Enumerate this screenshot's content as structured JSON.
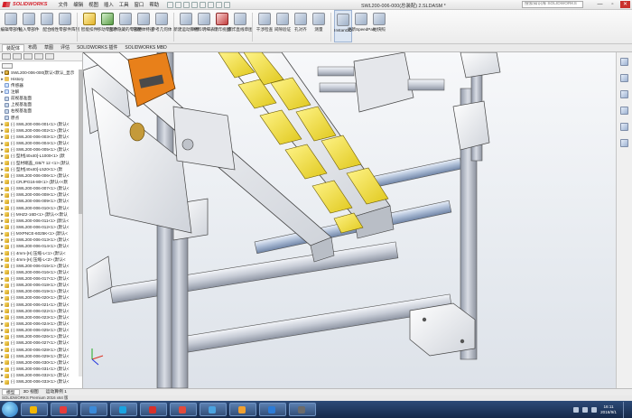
{
  "app": {
    "logo_text": "SOLIDWORKS",
    "menu": [
      "文件",
      "编辑",
      "视图",
      "插入",
      "工具",
      "窗口",
      "帮助"
    ],
    "document_title": "SWL200-006-000(总装配) 2.SLDASM *",
    "search_placeholder": "搜索知识库 SOLIDWORKS",
    "window_controls": [
      "—",
      "▫",
      "✕"
    ]
  },
  "ribbon": {
    "buttons": [
      {
        "label": "编辑零部件",
        "icon": "edit-component-icon",
        "tone": ""
      },
      {
        "label": "插入零部件",
        "icon": "insert-component-icon",
        "tone": ""
      },
      {
        "label": "配合",
        "icon": "mate-icon",
        "tone": ""
      },
      {
        "label": "线性零部件阵列",
        "icon": "linear-pattern-icon",
        "tone": ""
      },
      {
        "label": "智能扣件",
        "icon": "smart-fasteners-icon",
        "tone": "y"
      },
      {
        "label": "移动零部件",
        "icon": "move-component-icon",
        "tone": "g"
      },
      {
        "label": "显示隐藏的零部件",
        "icon": "show-hidden-icon",
        "tone": ""
      },
      {
        "label": "装配体特征",
        "icon": "assembly-features-icon",
        "tone": ""
      },
      {
        "label": "参考几何体",
        "icon": "reference-geometry-icon",
        "tone": ""
      },
      {
        "label": "新建运动算例",
        "icon": "motion-study-icon",
        "tone": ""
      },
      {
        "label": "材料明细表",
        "icon": "bom-icon",
        "tone": ""
      },
      {
        "label": "爆炸视图",
        "icon": "exploded-view-icon",
        "tone": "r"
      },
      {
        "label": "爆炸直线草图",
        "icon": "explode-line-icon",
        "tone": ""
      },
      {
        "label": "干涉检查",
        "icon": "interference-icon",
        "tone": ""
      },
      {
        "label": "间隙验证",
        "icon": "clearance-icon",
        "tone": ""
      },
      {
        "label": "孔对齐",
        "icon": "hole-alignment-icon",
        "tone": ""
      },
      {
        "label": "测量",
        "icon": "measure-icon",
        "tone": ""
      },
      {
        "label": "Instant3D",
        "icon": "instant3d-icon",
        "tone": "active"
      },
      {
        "label": "更新SpeedPak",
        "icon": "speedpak-icon",
        "tone": ""
      },
      {
        "label": "拍快照",
        "icon": "snapshot-icon",
        "tone": ""
      }
    ]
  },
  "command_tabs": [
    {
      "label": "装配体",
      "active": true
    },
    {
      "label": "布局",
      "active": false
    },
    {
      "label": "草图",
      "active": false
    },
    {
      "label": "评估",
      "active": false
    },
    {
      "label": "SOLIDWORKS 插件",
      "active": false
    },
    {
      "label": "SOLIDWORKS MBD",
      "active": false
    }
  ],
  "feature_tree": {
    "items": [
      {
        "text": "SWL200-006-000(默认<默认_显示",
        "kind": "asm",
        "exp": "▾"
      },
      {
        "text": "History",
        "kind": "folder",
        "exp": "▸"
      },
      {
        "text": "传感器",
        "kind": "note",
        "exp": ""
      },
      {
        "text": "注解",
        "kind": "note",
        "exp": "▸"
      },
      {
        "text": "前视基准面",
        "kind": "plane",
        "exp": ""
      },
      {
        "text": "上视基准面",
        "kind": "plane",
        "exp": ""
      },
      {
        "text": "右视基准面",
        "kind": "plane",
        "exp": ""
      },
      {
        "text": "原点",
        "kind": "plane",
        "exp": ""
      },
      {
        "text": "(-) SWL200-006-001<1> (默认<",
        "kind": "part",
        "exp": "▸"
      },
      {
        "text": "(-) SWL200-006-002<1> (默认<",
        "kind": "part",
        "exp": "▸"
      },
      {
        "text": "(-) SWL200-006-003<1> (默认<",
        "kind": "part",
        "exp": "▸"
      },
      {
        "text": "(-) SWL200-006-004<1> (默认<",
        "kind": "part",
        "exp": "▸"
      },
      {
        "text": "(-) SWL200-006-005<1> (默认<",
        "kind": "part",
        "exp": "▸"
      },
      {
        "text": "(-) 型材[40x40]-L1000<1> (默",
        "kind": "part",
        "exp": "▸"
      },
      {
        "text": "(-) 型材端盖_GB/T 12 <1> (默认",
        "kind": "part",
        "exp": "▸"
      },
      {
        "text": "(-) 型材[40x40]-L520<1> (默",
        "kind": "part",
        "exp": "▸"
      },
      {
        "text": "(-) SWL200-006-006<1> (默认<",
        "kind": "part",
        "exp": "▸"
      },
      {
        "text": "(-) CRJPG16-80<1> (默认<<默",
        "kind": "part",
        "exp": "▸"
      },
      {
        "text": "(-) SWL200-006-007<1> (默认<",
        "kind": "part",
        "exp": "▸"
      },
      {
        "text": "(-) SWL200-006-008<1> (默认<",
        "kind": "part",
        "exp": "▸"
      },
      {
        "text": "(-) SWL200-006-009<1> (默认<",
        "kind": "part",
        "exp": "▸"
      },
      {
        "text": "(-) SWL200-006-010<1> (默认<",
        "kind": "part",
        "exp": "▸"
      },
      {
        "text": "(-) MHZ2-16D<1> (默认<<默认",
        "kind": "part",
        "exp": "▸"
      },
      {
        "text": "(-) SWL200-006-011<1> (默认<",
        "kind": "part",
        "exp": "▸"
      },
      {
        "text": "(-) SWL200-006-012<1> (默认<",
        "kind": "part",
        "exp": "▸"
      },
      {
        "text": "(-) MXPNCE-6025K<1> (默认<",
        "kind": "part",
        "exp": "▸"
      },
      {
        "text": "(-) SWL200-006-013<1> (默认<",
        "kind": "part",
        "exp": "▸"
      },
      {
        "text": "(-) SWL200-006-014<1> (默认<",
        "kind": "part",
        "exp": "▸"
      },
      {
        "text": "(-) 4mm-[H] 压缩-L<1> (默认<",
        "kind": "part",
        "exp": "▸"
      },
      {
        "text": "(-) 4mm-[H] 压缩-L<2> (默认<",
        "kind": "part",
        "exp": "▸"
      },
      {
        "text": "(-) SWL200-006-015<1> (默认<",
        "kind": "part",
        "exp": "▸"
      },
      {
        "text": "(-) SWL200-006-016<1> (默认<",
        "kind": "part",
        "exp": "▸"
      },
      {
        "text": "(-) SWL200-006-017<1> (默认<",
        "kind": "part",
        "exp": "▸"
      },
      {
        "text": "(-) SWL200-006-018<1> (默认<",
        "kind": "part",
        "exp": "▸"
      },
      {
        "text": "(-) SWL200-006-019<1> (默认<",
        "kind": "part",
        "exp": "▸"
      },
      {
        "text": "(-) SWL200-006-020<1> (默认<",
        "kind": "part",
        "exp": "▸"
      },
      {
        "text": "(-) SWL200-006-021<1> (默认<",
        "kind": "part",
        "exp": "▸"
      },
      {
        "text": "(-) SWL200-006-022<1> (默认<",
        "kind": "part",
        "exp": "▸"
      },
      {
        "text": "(-) SWL200-006-023<1> (默认<",
        "kind": "part",
        "exp": "▸"
      },
      {
        "text": "(-) SWL200-006-024<1> (默认<",
        "kind": "part",
        "exp": "▸"
      },
      {
        "text": "(-) SWL200-006-025<1> (默认<",
        "kind": "part",
        "exp": "▸"
      },
      {
        "text": "(-) SWL200-006-026<1> (默认<",
        "kind": "part",
        "exp": "▸"
      },
      {
        "text": "(-) SWL200-006-027<1> (默认<",
        "kind": "part",
        "exp": "▸"
      },
      {
        "text": "(-) SWL200-006-028<1> (默认<",
        "kind": "part",
        "exp": "▸"
      },
      {
        "text": "(-) SWL200-006-029<1> (默认<",
        "kind": "part",
        "exp": "▸"
      },
      {
        "text": "(-) SWL200-006-030<1> (默认<",
        "kind": "part",
        "exp": "▸"
      },
      {
        "text": "(-) SWL200-006-031<1> (默认<",
        "kind": "part",
        "exp": "▸"
      },
      {
        "text": "(-) SWL200-006-032<1> (默认<",
        "kind": "part",
        "exp": "▸"
      },
      {
        "text": "(-) SWL200-006-033<1> (默认<",
        "kind": "part",
        "exp": "▸"
      }
    ]
  },
  "model_tabs": [
    {
      "label": "模型",
      "active": true
    },
    {
      "label": "3D 视图",
      "active": false
    },
    {
      "label": "运动算例 1",
      "active": false
    }
  ],
  "status": {
    "text": "SOLIDWORKS Premium 2016 x64 版"
  },
  "taskbar": {
    "apps": [
      {
        "label": "",
        "color": "#f2b705",
        "icon": "folder-icon"
      },
      {
        "label": "",
        "color": "#e63c3c",
        "icon": "media-player-icon"
      },
      {
        "label": "",
        "color": "#3b8ad8",
        "icon": "browser-icon"
      },
      {
        "label": "",
        "color": "#19a3e0",
        "icon": "qq-icon"
      },
      {
        "label": "",
        "color": "#d8302a",
        "icon": "solidworks-icon"
      },
      {
        "label": "",
        "color": "#e24a3c",
        "icon": "record-icon"
      },
      {
        "label": "",
        "color": "#4aa3df",
        "icon": "chat-icon"
      },
      {
        "label": "",
        "color": "#f0a030",
        "icon": "player-icon"
      },
      {
        "label": "",
        "color": "#2c7bd6",
        "icon": "word-icon"
      },
      {
        "label": "",
        "color": "#6b6b6b",
        "icon": "explorer-icon"
      }
    ],
    "clock_time": "16:11",
    "clock_date": "2016/9/1"
  }
}
